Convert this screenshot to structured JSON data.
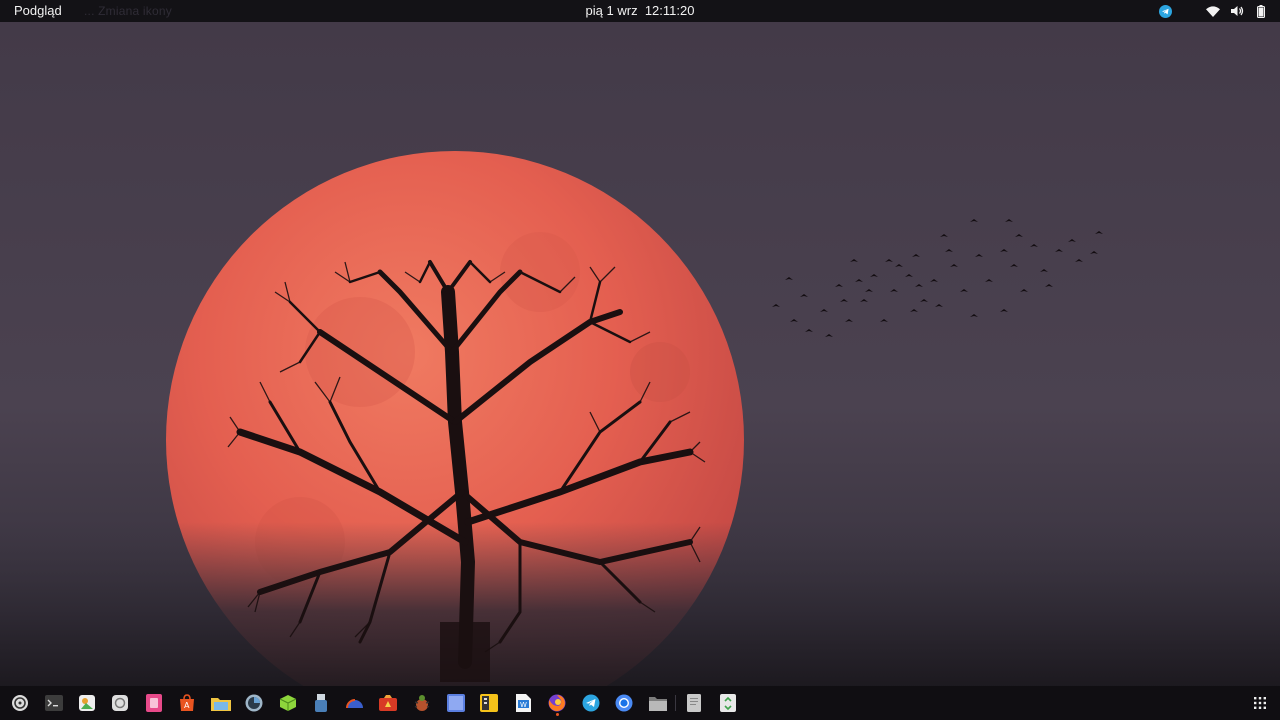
{
  "topbar": {
    "activities": "Podgląd",
    "app_hint": "... Zmiana ikony",
    "day": "pią 1 wrz",
    "time": "12:11:20",
    "tray": [
      "telegram-icon",
      "wifi-icon",
      "volume-icon",
      "battery-icon"
    ]
  },
  "colors": {
    "moon": "#e2604f",
    "sky": "#433a48",
    "panel": "#131216",
    "accent": "#e95420"
  },
  "dock": {
    "items": [
      "software-updater-icon",
      "terminal-icon",
      "image-viewer-icon",
      "screenshot-icon",
      "media-player-icon",
      "app-center-icon",
      "folder-preview-icon",
      "disk-usage-icon",
      "box-app-icon",
      "usb-creator-icon",
      "system-monitor-icon",
      "camera-app-icon",
      "bug-tracker-icon",
      "window-app-icon",
      "archive-manager-icon",
      "document-editor-icon",
      "firefox-icon",
      "telegram-icon",
      "chromium-icon",
      "files-icon",
      "text-editor-icon",
      "trash-icon",
      "show-apps-icon"
    ]
  }
}
